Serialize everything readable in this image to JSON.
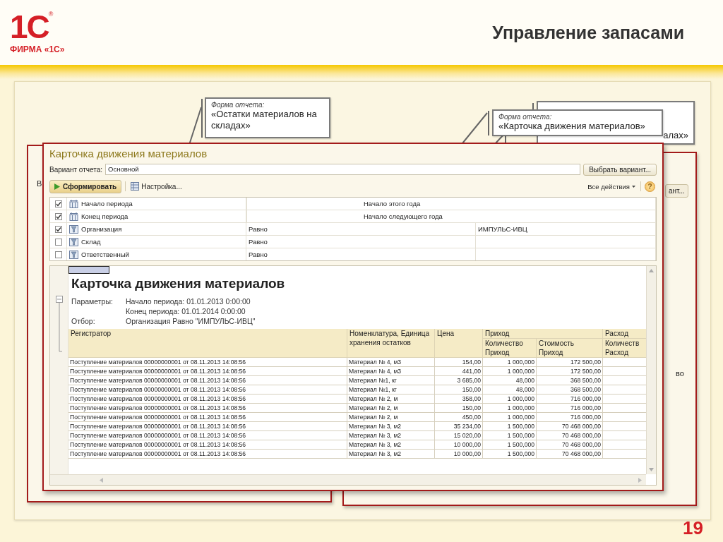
{
  "logo": {
    "mark": "1С",
    "registered": "®",
    "caption": "ФИРМА «1С»"
  },
  "slide": {
    "title": "Управление запасами",
    "page_number": "19"
  },
  "back_windows": {
    "left_label": "В",
    "right_button": "ант...",
    "right_cell": "во"
  },
  "back_callout": {
    "text": "алах»"
  },
  "callouts": [
    {
      "caption": "Форма отчета:",
      "text": "«Остатки материалов на складах»"
    },
    {
      "caption": "Форма отчета:",
      "text": "«Карточка движения материалов»"
    }
  ],
  "window": {
    "title": "Карточка движения материалов",
    "variant_label": "Вариант отчета:",
    "variant": "Основной",
    "choose_button": "Выбрать вариант...",
    "generate_button": "Сформировать",
    "settings_button": "Настройка...",
    "all_actions": "Все действия",
    "help": "?"
  },
  "filters": [
    {
      "kind": "period",
      "checked": true,
      "name": "Начало периода",
      "value": "Начало этого года"
    },
    {
      "kind": "period",
      "checked": true,
      "name": "Конец периода",
      "value": "Начало следующего года"
    },
    {
      "kind": "filter",
      "checked": true,
      "name": "Организация",
      "condition": "Равно",
      "value": "ИМПУЛЬС-ИВЦ"
    },
    {
      "kind": "filter",
      "checked": false,
      "name": "Склад",
      "condition": "Равно"
    },
    {
      "kind": "filter",
      "checked": false,
      "name": "Ответственный",
      "condition": "Равно"
    }
  ],
  "report": {
    "title": "Карточка движения материалов",
    "params_label": "Параметры:",
    "params": [
      "Начало периода: 01.01.2013 0:00:00",
      "Конец периода: 01.01.2014 0:00:00"
    ],
    "filter_label": "Отбор:",
    "filter": "Организация Равно \"ИМПУЛЬС-ИВЦ\"",
    "columns": {
      "registrar": "Регистратор",
      "item": "Номенклатура, Единица хранения остатков",
      "price": "Цена",
      "income": "Приход",
      "income_qty": "Количество Приход",
      "income_cost": "Стоимость Приход",
      "expense": "Расход",
      "expense_qty": "Количеств Расход"
    },
    "rows": [
      [
        "Поступление материалов 00000000001 от 08.11.2013 14:08:56",
        "Материал № 4, м3",
        "154,00",
        "1 000,000",
        "172 500,00"
      ],
      [
        "Поступление материалов 00000000001 от 08.11.2013 14:08:56",
        "Материал № 4, м3",
        "441,00",
        "1 000,000",
        "172 500,00"
      ],
      [
        "Поступление материалов 00000000001 от 08.11.2013 14:08:56",
        "Материал №1, кг",
        "3 685,00",
        "48,000",
        "368 500,00"
      ],
      [
        "Поступление материалов 00000000001 от 08.11.2013 14:08:56",
        "Материал №1, кг",
        "150,00",
        "48,000",
        "368 500,00"
      ],
      [
        "Поступление материалов 00000000001 от 08.11.2013 14:08:56",
        "Материал № 2, м",
        "358,00",
        "1 000,000",
        "716 000,00"
      ],
      [
        "Поступление материалов 00000000001 от 08.11.2013 14:08:56",
        "Материал № 2, м",
        "150,00",
        "1 000,000",
        "716 000,00"
      ],
      [
        "Поступление материалов 00000000001 от 08.11.2013 14:08:56",
        "Материал № 2, м",
        "450,00",
        "1 000,000",
        "716 000,00"
      ],
      [
        "Поступление материалов 00000000001 от 08.11.2013 14:08:56",
        "Материал № 3, м2",
        "35 234,00",
        "1 500,000",
        "70 468 000,00"
      ],
      [
        "Поступление материалов 00000000001 от 08.11.2013 14:08:56",
        "Материал № 3, м2",
        "15 020,00",
        "1 500,000",
        "70 468 000,00"
      ],
      [
        "Поступление материалов 00000000001 от 08.11.2013 14:08:56",
        "Материал № 3, м2",
        "10 000,00",
        "1 500,000",
        "70 468 000,00"
      ],
      [
        "Поступление материалов 00000000001 от 08.11.2013 14:08:56",
        "Материал № 3, м2",
        "10 000,00",
        "1 500,000",
        "70 468 000,00"
      ]
    ]
  }
}
